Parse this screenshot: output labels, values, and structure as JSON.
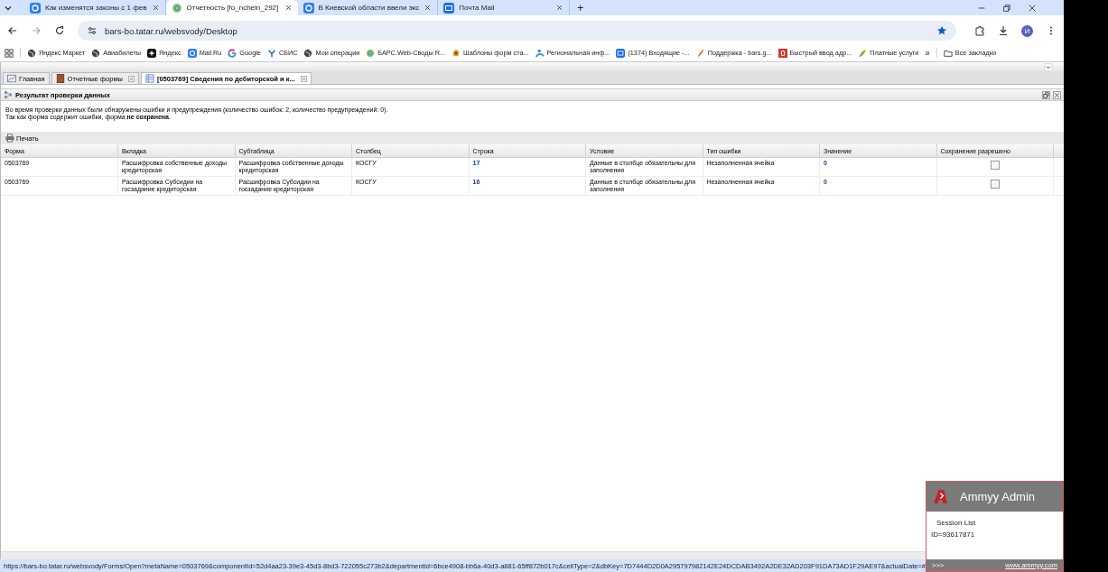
{
  "browser": {
    "tabs": [
      {
        "title": "Как изменятся законы с 1 фев",
        "kind": "mail",
        "selected": false
      },
      {
        "title": "Отчетность [fo_ncheln_292]",
        "kind": "bars",
        "selected": true
      },
      {
        "title": "В Киевской области ввели экс",
        "kind": "mail",
        "selected": false
      },
      {
        "title": "Почта Mail",
        "kind": "inbox",
        "selected": false
      }
    ],
    "new_tab": "+",
    "address": "bars-bo.tatar.ru/websvody/Desktop",
    "profile": "И",
    "bookmarks": [
      {
        "label": "Яндекс Маркет",
        "kind": "globe"
      },
      {
        "label": "Авиабилеты",
        "kind": "globe"
      },
      {
        "label": "Яндекс",
        "kind": "plus"
      },
      {
        "label": "Mail.Ru",
        "kind": "mail"
      },
      {
        "label": "Google",
        "kind": "google"
      },
      {
        "label": "СБИС",
        "kind": "sbis"
      },
      {
        "label": "Мои операции",
        "kind": "globe"
      },
      {
        "label": "БАРС.Web-Своды R...",
        "kind": "bars"
      },
      {
        "label": "Шаблоны форм ста...",
        "kind": "emblem"
      },
      {
        "label": "Региональная инф...",
        "kind": "region"
      },
      {
        "label": "(1374) Входящие -...",
        "kind": "inbox"
      },
      {
        "label": "Поддержка - bars.g...",
        "kind": "feather"
      },
      {
        "label": "Быстрый ввод адр...",
        "kind": "red"
      },
      {
        "label": "Платные услуги",
        "kind": "leaf"
      }
    ],
    "overflow": "»",
    "all_bookmarks": "Все закладки"
  },
  "app": {
    "tabs": [
      {
        "label": "Главная",
        "kind": "chart",
        "closable": false,
        "selected": false
      },
      {
        "label": "Отчетные формы",
        "kind": "book",
        "closable": true,
        "selected": false
      },
      {
        "label": "[0503769] Сведения по дебиторской и к...",
        "kind": "sheet",
        "closable": true,
        "selected": true
      }
    ],
    "panel_title": "Результат проверки данных",
    "message": [
      "Во время проверки данных были обнаружены ошибки и предупреждения (количество ошибок: 2, количество предупреждений: 0).",
      "Так как форма содержит ошибки, форма **не сохранена**."
    ],
    "print": "Печать",
    "table": {
      "columns": [
        {
          "label": "Форма",
          "kind": "text"
        },
        {
          "label": "Вкладка",
          "kind": "text"
        },
        {
          "label": "Субтаблица",
          "kind": "text"
        },
        {
          "label": "Столбец",
          "kind": "text"
        },
        {
          "label": "Строка",
          "kind": "number"
        },
        {
          "label": "Условие",
          "kind": "text"
        },
        {
          "label": "Тип ошибки",
          "kind": "text"
        },
        {
          "label": "Значение",
          "kind": "number"
        },
        {
          "label": "Сохранение разрешено",
          "kind": "check"
        }
      ],
      "rows": [
        {
          "cells": [
            "0503769",
            "Расшифровка собственные доходы кредиторская",
            "Расшифровка собственные доходы кредиторская",
            "КОСГУ",
            "17",
            "Данные в столбце обязательны для заполнения",
            "Незаполненная ячейка",
            "0"
          ],
          "save_allowed": false
        },
        {
          "cells": [
            "0503769",
            "Расшифровка Субсидии на госзадание кредиторская",
            "Расшифровка Субсидии на госзадание кредиторская",
            "КОСГУ",
            "16",
            "Данные в столбце обязательны для заполнения",
            "Незаполненная ячейка",
            "0"
          ],
          "save_allowed": false
        }
      ]
    }
  },
  "status_url": "https://bars-bo.tatar.ru/websvody/Forms/Open?metaName=0503769&componentId=52d4aa23-39e3-45d3-8bd3-722055c273b2&departmentId=6bce4908-bb6a-40d3-a881-65ff872b017c&cellType=2&dbKey=7D7444D2D0A295797982142E24DCDAB3492A2DE32AD203F91DA73AD1F29AE97&actualDate=#",
  "ammyy": {
    "title": "Ammyy Admin",
    "session_list": "Session List",
    "id": "ID=93617871",
    "expand": ">>>",
    "link": "www.ammyy.com"
  }
}
